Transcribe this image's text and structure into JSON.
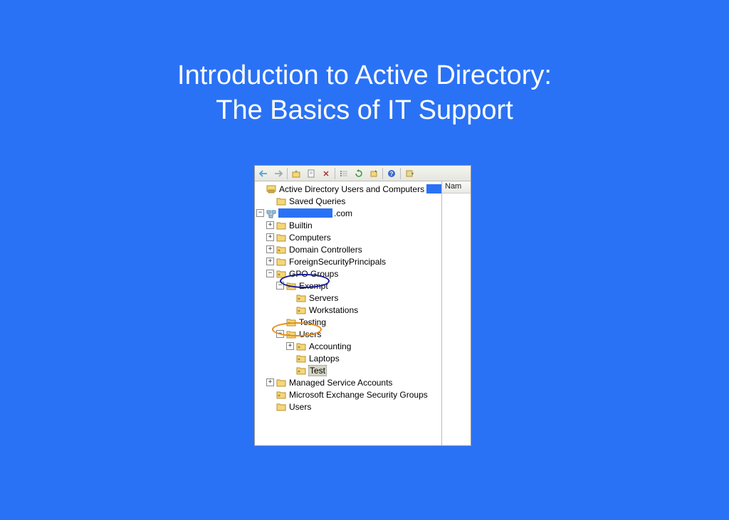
{
  "title": {
    "line1": "Introduction to Active Directory:",
    "line2": "The Basics of IT Support"
  },
  "columnHeader": "Nam",
  "rootLabel": "Active Directory Users and Computers",
  "domainSuffix": ".com",
  "tree": {
    "savedQueries": "Saved Queries",
    "builtin": "Builtin",
    "computers": "Computers",
    "domainControllers": "Domain Controllers",
    "foreignSec": "ForeignSecurityPrincipals",
    "gpoGroups": "GPO Groups",
    "exempt": "Exempt",
    "servers": "Servers",
    "workstations": "Workstations",
    "testing": "Testing",
    "usersOU": "Users",
    "accounting": "Accounting",
    "laptops": "Laptops",
    "test": "Test",
    "msa": "Managed Service Accounts",
    "mesg": "Microsoft Exchange Security Groups",
    "users": "Users"
  }
}
